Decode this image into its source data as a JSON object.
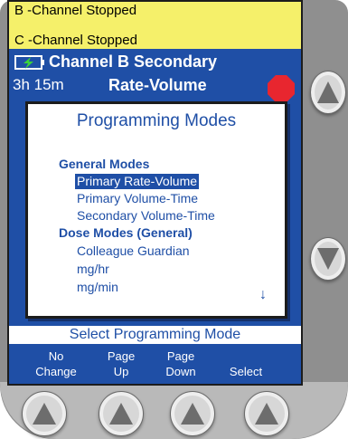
{
  "alerts": {
    "line1": "B -Channel Stopped",
    "line2": "C -Channel Stopped"
  },
  "channel": {
    "title": "Channel B Secondary",
    "elapsed": "3h 15m",
    "mode": "Rate-Volume",
    "battery_icon": "battery-charging-icon",
    "stop_icon": "stop-octagon-icon"
  },
  "dialog": {
    "title": "Programming Modes",
    "items": [
      {
        "label": "General Modes",
        "kind": "header"
      },
      {
        "label": "Primary Rate-Volume",
        "kind": "mode",
        "selected": true
      },
      {
        "label": "Primary Volume-Time",
        "kind": "mode"
      },
      {
        "label": "Secondary Volume-Time",
        "kind": "mode"
      },
      {
        "label": "Dose Modes (General)",
        "kind": "header"
      },
      {
        "label": "Colleague Guardian",
        "kind": "mode"
      },
      {
        "label": "mg/hr",
        "kind": "mode"
      },
      {
        "label": "mg/min",
        "kind": "mode"
      }
    ],
    "more_indicator": "↓"
  },
  "prompt": "Select Programming Mode",
  "softkeys": [
    {
      "line1": "No",
      "line2": "Change"
    },
    {
      "line1": "Page",
      "line2": "Up"
    },
    {
      "line1": "Page",
      "line2": "Down"
    },
    {
      "line1": "",
      "line2": "Select"
    }
  ],
  "colors": {
    "screen_blue": "#1f4fa6",
    "alert_yellow": "#f5f06a",
    "stop_red": "#e8262f",
    "battery_green": "#3bd23b"
  }
}
